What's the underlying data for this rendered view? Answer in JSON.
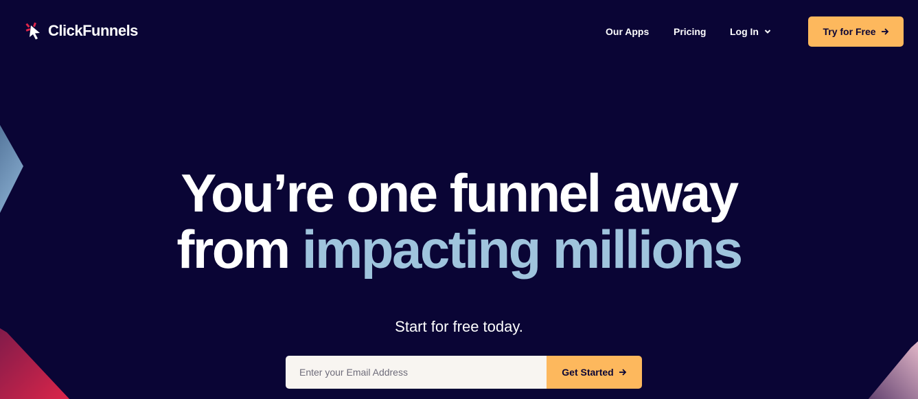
{
  "brand": {
    "name": "ClickFunnels",
    "icon": "clickfunnels-logo-icon"
  },
  "nav": {
    "items": [
      {
        "label": "Our Apps"
      },
      {
        "label": "Pricing"
      },
      {
        "label": "Log In",
        "icon": "chevron-down-icon"
      }
    ],
    "cta_label": "Try for Free",
    "cta_icon": "arrow-right-icon"
  },
  "hero": {
    "line1": "You’re one funnel away",
    "line2_plain": "from ",
    "line2_accent": "impacting millions",
    "subtitle": "Start for free today."
  },
  "form": {
    "email_placeholder": "Enter your Email Address",
    "submit_label": "Get Started",
    "submit_icon": "arrow-right-icon"
  },
  "colors": {
    "background": "#0a0535",
    "accent_text": "#9fc4dd",
    "button": "#fdb85d",
    "input_bg": "#f8f5f1"
  }
}
